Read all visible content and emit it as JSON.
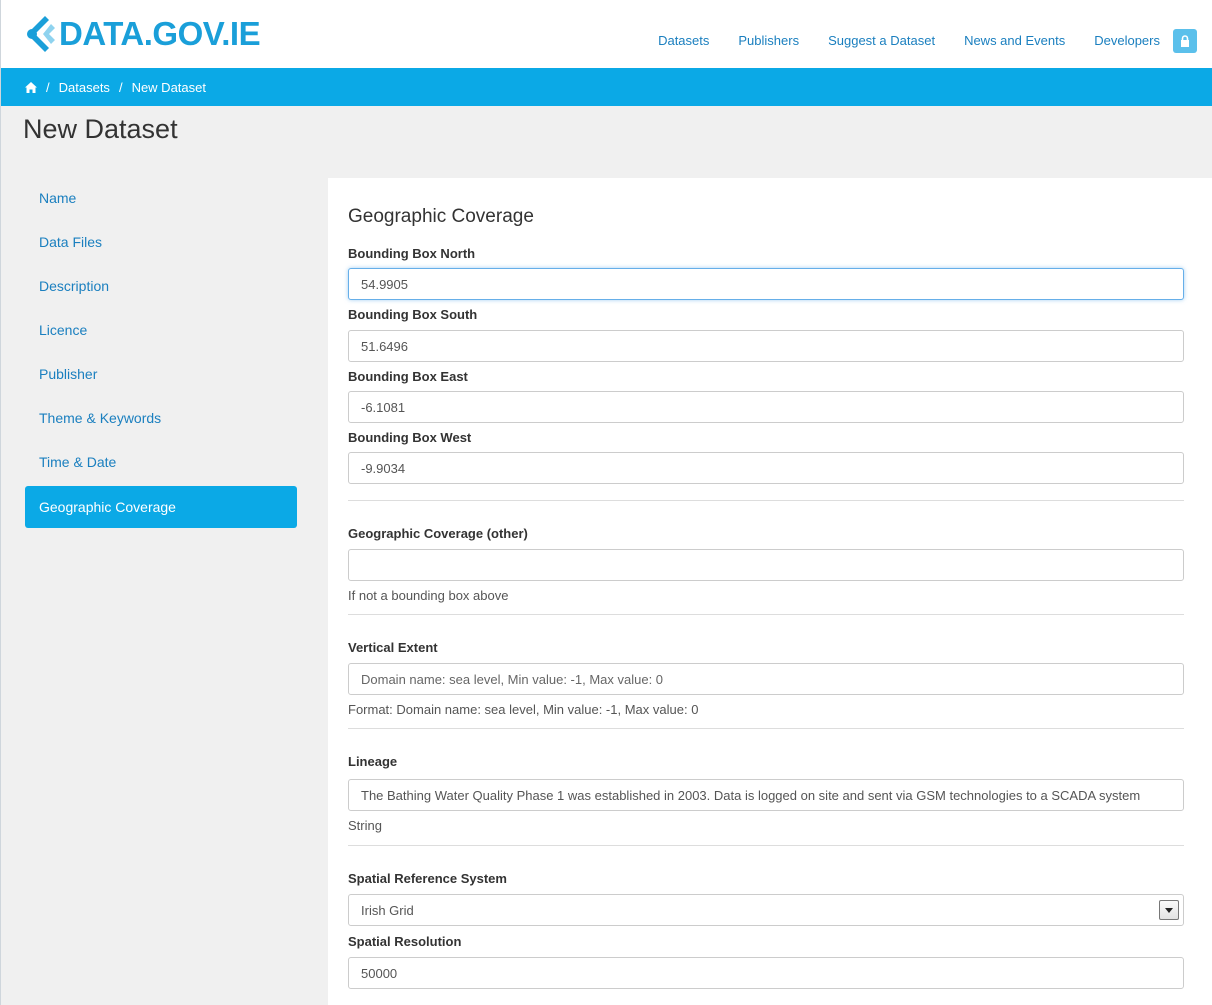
{
  "header": {
    "logo_text": "DATA.GOV.IE",
    "nav": [
      "Datasets",
      "Publishers",
      "Suggest a Dataset",
      "News and Events",
      "Developers"
    ]
  },
  "breadcrumb": {
    "items": [
      "Datasets",
      "New Dataset"
    ],
    "separator": "/"
  },
  "page": {
    "title": "New Dataset"
  },
  "sidebar": {
    "items": [
      {
        "label": "Name"
      },
      {
        "label": "Data Files"
      },
      {
        "label": "Description"
      },
      {
        "label": "Licence"
      },
      {
        "label": "Publisher"
      },
      {
        "label": "Theme & Keywords"
      },
      {
        "label": "Time & Date"
      },
      {
        "label": "Geographic Coverage"
      }
    ],
    "active": "Geographic Coverage"
  },
  "form": {
    "section_title": "Geographic Coverage",
    "bbox_north": {
      "label": "Bounding Box North",
      "value": "54.9905"
    },
    "bbox_south": {
      "label": "Bounding Box South",
      "value": "51.6496"
    },
    "bbox_east": {
      "label": "Bounding Box East",
      "value": "-6.1081"
    },
    "bbox_west": {
      "label": "Bounding Box West",
      "value": "-9.9034"
    },
    "geo_other": {
      "label": "Geographic Coverage (other)",
      "value": "",
      "help": "If not a bounding box above"
    },
    "vertical_extent": {
      "label": "Vertical Extent",
      "placeholder": "Domain name: sea level, Min value: -1, Max value: 0",
      "help": "Format: Domain name: sea level, Min value: -1, Max value: 0"
    },
    "lineage": {
      "label": "Lineage",
      "value": "The Bathing Water Quality Phase 1 was established in 2003. Data is logged on site and sent via GSM technologies to a SCADA system",
      "help": "String"
    },
    "srs": {
      "label": "Spatial Reference System",
      "value": "Irish Grid"
    },
    "spatial_resolution": {
      "label": "Spatial Resolution",
      "value": "50000"
    }
  },
  "colors": {
    "brand": "#1a9fd9",
    "bar": "#0ba9e6",
    "link": "#1a7fbf"
  }
}
